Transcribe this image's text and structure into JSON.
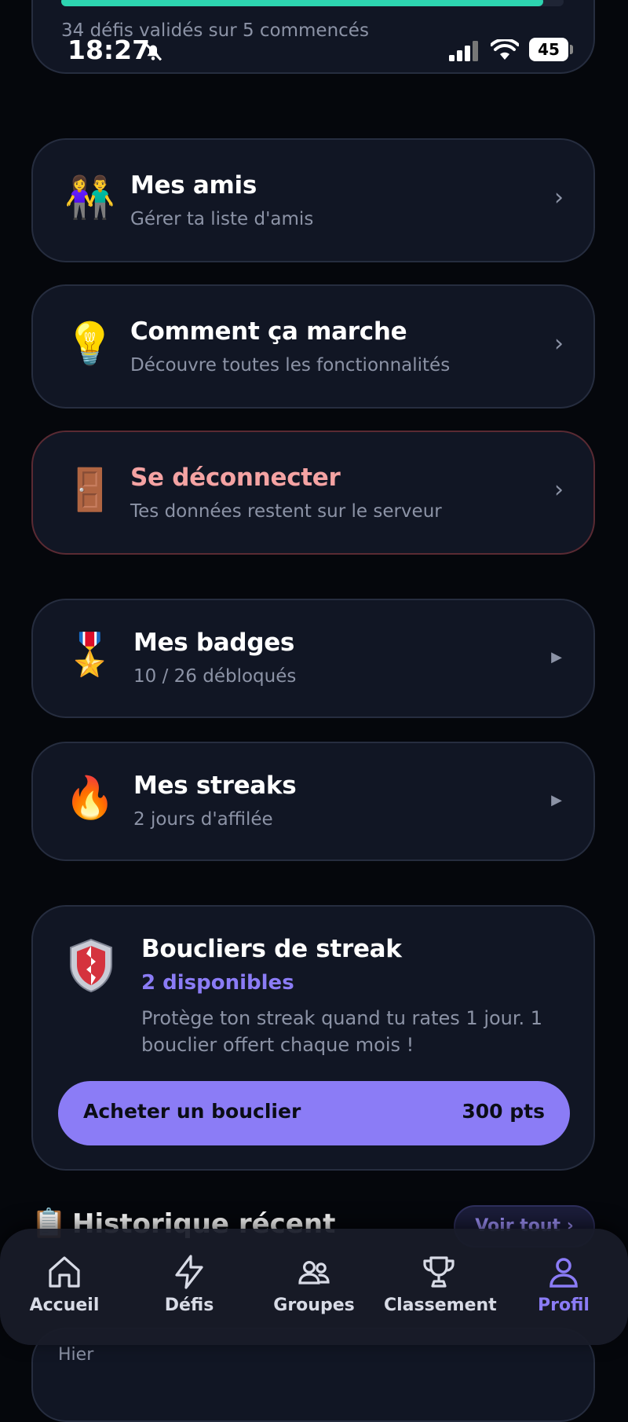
{
  "status_bar": {
    "time": "18:27",
    "battery": "45"
  },
  "progress_card": {
    "text": "34 défis validés sur 5 commencés"
  },
  "menu": {
    "friends": {
      "icon": "👫",
      "title": "Mes amis",
      "subtitle": "Gérer ta liste d'amis"
    },
    "how": {
      "icon": "💡",
      "title": "Comment ça marche",
      "subtitle": "Découvre toutes les fonctionnalités"
    },
    "logout": {
      "icon": "🚪",
      "title": "Se déconnecter",
      "subtitle": "Tes données restent sur le serveur"
    },
    "badges": {
      "icon": "🎖️",
      "title": "Mes badges",
      "subtitle": "10 / 26 débloqués"
    },
    "streaks": {
      "icon": "🔥",
      "title": "Mes streaks",
      "subtitle": "2 jours d'affilée"
    }
  },
  "shields": {
    "title": "Boucliers de streak",
    "available": "2 disponibles",
    "description_line1": "Protège ton streak quand tu rates 1 jour. 1",
    "description_line2": "bouclier offert chaque mois !",
    "buy_label": "Acheter un bouclier",
    "buy_price": "300 pts"
  },
  "history": {
    "icon": "📋",
    "title": "Historique récent",
    "see_all": "Voir tout ›",
    "first_group": "Hier"
  },
  "tabbar": {
    "home": "Accueil",
    "challenges": "Défis",
    "groups": "Groupes",
    "ranking": "Classement",
    "profile": "Profil"
  },
  "colors": {
    "accent": "#8b7cf6",
    "danger_text": "#f4a3a3",
    "progress": "#2dd4b0"
  }
}
